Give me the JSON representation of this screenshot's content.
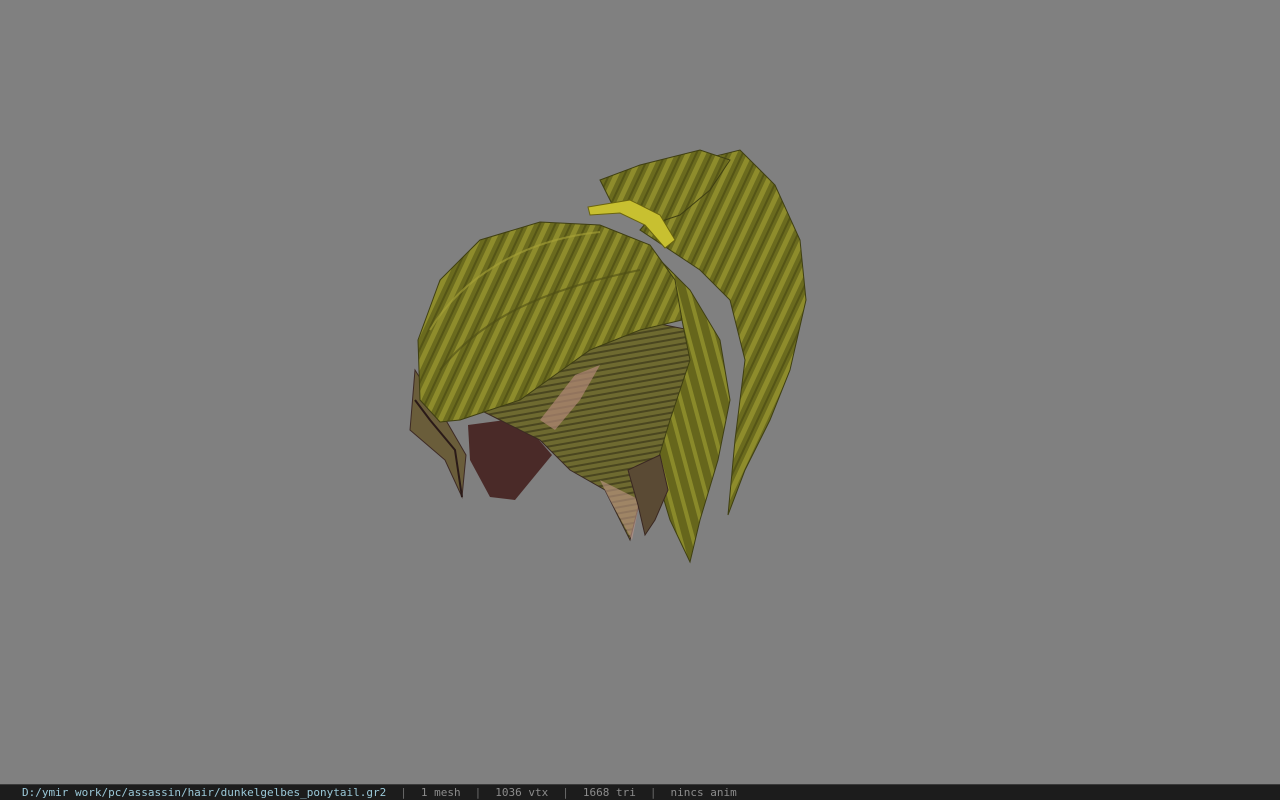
{
  "viewer": {
    "background_color": "#808080",
    "model_name": "dunkelgelbes_ponytail",
    "model_icon": "hair-model-icon"
  },
  "statusbar": {
    "file_path": "D:/ymir work/pc/assassin/hair/dunkelgelbes_ponytail.gr2",
    "separator": "|",
    "mesh": "1 mesh",
    "vertices": "1036 vtx",
    "triangles": "1668 tri",
    "anim": "nincs anim"
  }
}
